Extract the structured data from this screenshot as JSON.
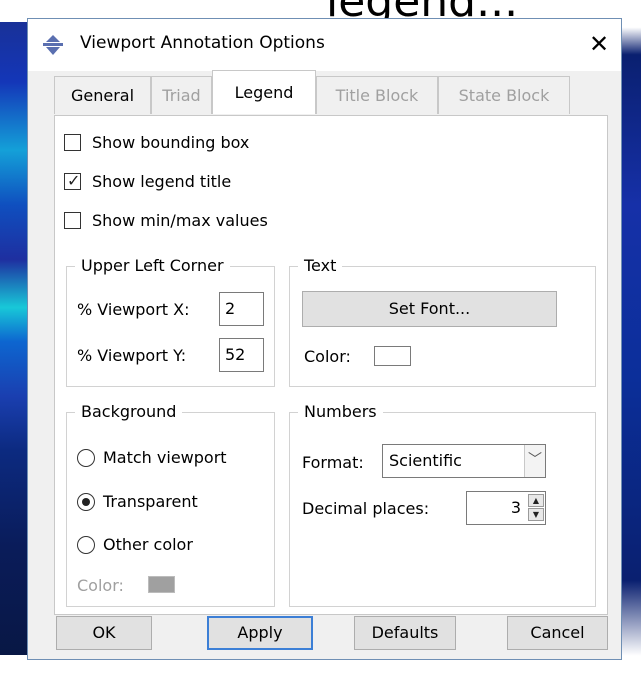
{
  "background": {
    "caption": "legend..."
  },
  "window": {
    "title": "Viewport Annotation Options",
    "close_glyph": "✕"
  },
  "tabs": [
    {
      "label": "General",
      "state": "normal"
    },
    {
      "label": "Triad",
      "state": "disabled"
    },
    {
      "label": "Legend",
      "state": "active"
    },
    {
      "label": "Title Block",
      "state": "disabled"
    },
    {
      "label": "State Block",
      "state": "disabled"
    }
  ],
  "checkboxes": {
    "bounding_box": {
      "label": "Show bounding box",
      "checked": false
    },
    "legend_title": {
      "label": "Show legend title",
      "checked": true
    },
    "min_max": {
      "label": "Show min/max values",
      "checked": false
    }
  },
  "upper_left_corner": {
    "title": "Upper Left Corner",
    "x_label": "% Viewport X:",
    "x_value": "2",
    "y_label": "% Viewport Y:",
    "y_value": "52"
  },
  "text_group": {
    "title": "Text",
    "set_font_label": "Set Font...",
    "color_label": "Color:",
    "color_value": "#ffffff"
  },
  "background_group": {
    "title": "Background",
    "options": [
      "Match viewport",
      "Transparent",
      "Other color"
    ],
    "selected": "Transparent",
    "color_label": "Color:",
    "color_value": "#a0a0a0"
  },
  "numbers_group": {
    "title": "Numbers",
    "format_label": "Format:",
    "format_value": "Scientific",
    "decimal_label": "Decimal places:",
    "decimal_value": "3"
  },
  "footer": {
    "ok": "OK",
    "apply": "Apply",
    "defaults": "Defaults",
    "cancel": "Cancel"
  },
  "colors": {
    "accent": "#3c7fd6",
    "disabled_text": "#a0a0a0"
  }
}
